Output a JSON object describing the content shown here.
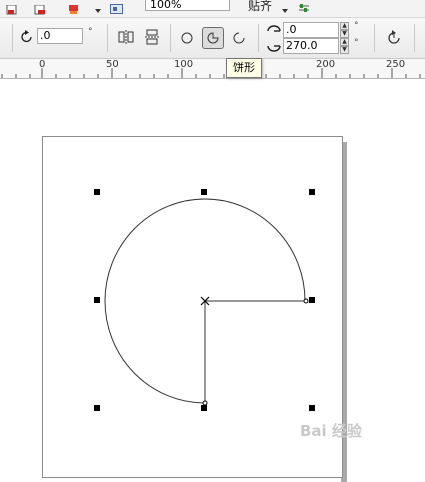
{
  "toolbar_top": {
    "zoom_value": "100%",
    "snap_label": "贴齐"
  },
  "property_bar": {
    "rotation_value": ".0",
    "rotation_unit": "°",
    "start_angle_value": ".0",
    "end_angle_value": "270.0",
    "angle_unit": "°",
    "shape_modes": [
      "ellipse",
      "pie",
      "arc"
    ],
    "active_mode": "pie"
  },
  "ruler": {
    "labels": [
      "0",
      "50",
      "100",
      "200",
      "250"
    ]
  },
  "tooltip": {
    "text": "饼形"
  },
  "watermark": {
    "text": "Bai 经验"
  },
  "colors": {
    "page_shadow": "#a9a9a9",
    "tooltip_bg": "#ffffe6",
    "toolbar_bg": "#efefef"
  }
}
